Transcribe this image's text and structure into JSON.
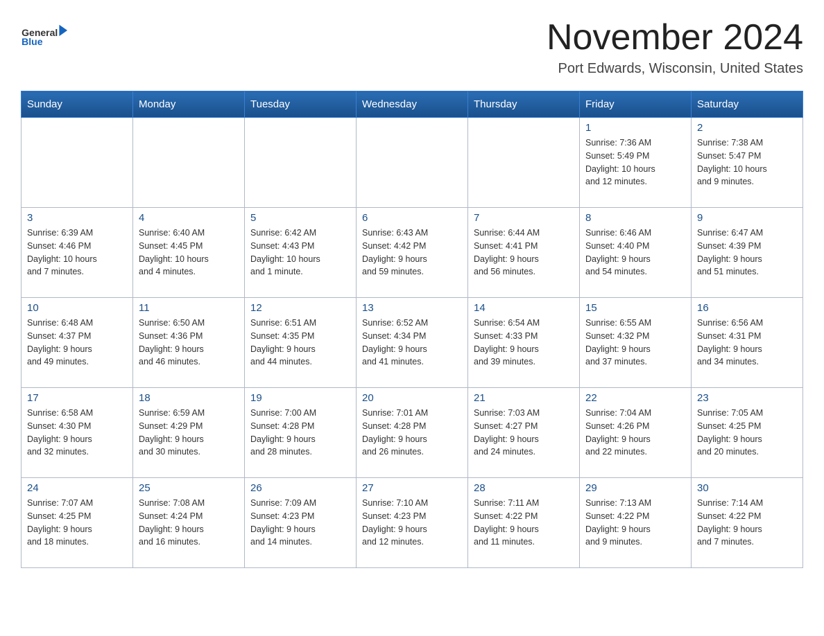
{
  "header": {
    "logo_text_general": "General",
    "logo_text_blue": "Blue",
    "title": "November 2024",
    "subtitle": "Port Edwards, Wisconsin, United States"
  },
  "calendar": {
    "days_of_week": [
      "Sunday",
      "Monday",
      "Tuesday",
      "Wednesday",
      "Thursday",
      "Friday",
      "Saturday"
    ],
    "weeks": [
      [
        {
          "day": "",
          "info": ""
        },
        {
          "day": "",
          "info": ""
        },
        {
          "day": "",
          "info": ""
        },
        {
          "day": "",
          "info": ""
        },
        {
          "day": "",
          "info": ""
        },
        {
          "day": "1",
          "info": "Sunrise: 7:36 AM\nSunset: 5:49 PM\nDaylight: 10 hours\nand 12 minutes."
        },
        {
          "day": "2",
          "info": "Sunrise: 7:38 AM\nSunset: 5:47 PM\nDaylight: 10 hours\nand 9 minutes."
        }
      ],
      [
        {
          "day": "3",
          "info": "Sunrise: 6:39 AM\nSunset: 4:46 PM\nDaylight: 10 hours\nand 7 minutes."
        },
        {
          "day": "4",
          "info": "Sunrise: 6:40 AM\nSunset: 4:45 PM\nDaylight: 10 hours\nand 4 minutes."
        },
        {
          "day": "5",
          "info": "Sunrise: 6:42 AM\nSunset: 4:43 PM\nDaylight: 10 hours\nand 1 minute."
        },
        {
          "day": "6",
          "info": "Sunrise: 6:43 AM\nSunset: 4:42 PM\nDaylight: 9 hours\nand 59 minutes."
        },
        {
          "day": "7",
          "info": "Sunrise: 6:44 AM\nSunset: 4:41 PM\nDaylight: 9 hours\nand 56 minutes."
        },
        {
          "day": "8",
          "info": "Sunrise: 6:46 AM\nSunset: 4:40 PM\nDaylight: 9 hours\nand 54 minutes."
        },
        {
          "day": "9",
          "info": "Sunrise: 6:47 AM\nSunset: 4:39 PM\nDaylight: 9 hours\nand 51 minutes."
        }
      ],
      [
        {
          "day": "10",
          "info": "Sunrise: 6:48 AM\nSunset: 4:37 PM\nDaylight: 9 hours\nand 49 minutes."
        },
        {
          "day": "11",
          "info": "Sunrise: 6:50 AM\nSunset: 4:36 PM\nDaylight: 9 hours\nand 46 minutes."
        },
        {
          "day": "12",
          "info": "Sunrise: 6:51 AM\nSunset: 4:35 PM\nDaylight: 9 hours\nand 44 minutes."
        },
        {
          "day": "13",
          "info": "Sunrise: 6:52 AM\nSunset: 4:34 PM\nDaylight: 9 hours\nand 41 minutes."
        },
        {
          "day": "14",
          "info": "Sunrise: 6:54 AM\nSunset: 4:33 PM\nDaylight: 9 hours\nand 39 minutes."
        },
        {
          "day": "15",
          "info": "Sunrise: 6:55 AM\nSunset: 4:32 PM\nDaylight: 9 hours\nand 37 minutes."
        },
        {
          "day": "16",
          "info": "Sunrise: 6:56 AM\nSunset: 4:31 PM\nDaylight: 9 hours\nand 34 minutes."
        }
      ],
      [
        {
          "day": "17",
          "info": "Sunrise: 6:58 AM\nSunset: 4:30 PM\nDaylight: 9 hours\nand 32 minutes."
        },
        {
          "day": "18",
          "info": "Sunrise: 6:59 AM\nSunset: 4:29 PM\nDaylight: 9 hours\nand 30 minutes."
        },
        {
          "day": "19",
          "info": "Sunrise: 7:00 AM\nSunset: 4:28 PM\nDaylight: 9 hours\nand 28 minutes."
        },
        {
          "day": "20",
          "info": "Sunrise: 7:01 AM\nSunset: 4:28 PM\nDaylight: 9 hours\nand 26 minutes."
        },
        {
          "day": "21",
          "info": "Sunrise: 7:03 AM\nSunset: 4:27 PM\nDaylight: 9 hours\nand 24 minutes."
        },
        {
          "day": "22",
          "info": "Sunrise: 7:04 AM\nSunset: 4:26 PM\nDaylight: 9 hours\nand 22 minutes."
        },
        {
          "day": "23",
          "info": "Sunrise: 7:05 AM\nSunset: 4:25 PM\nDaylight: 9 hours\nand 20 minutes."
        }
      ],
      [
        {
          "day": "24",
          "info": "Sunrise: 7:07 AM\nSunset: 4:25 PM\nDaylight: 9 hours\nand 18 minutes."
        },
        {
          "day": "25",
          "info": "Sunrise: 7:08 AM\nSunset: 4:24 PM\nDaylight: 9 hours\nand 16 minutes."
        },
        {
          "day": "26",
          "info": "Sunrise: 7:09 AM\nSunset: 4:23 PM\nDaylight: 9 hours\nand 14 minutes."
        },
        {
          "day": "27",
          "info": "Sunrise: 7:10 AM\nSunset: 4:23 PM\nDaylight: 9 hours\nand 12 minutes."
        },
        {
          "day": "28",
          "info": "Sunrise: 7:11 AM\nSunset: 4:22 PM\nDaylight: 9 hours\nand 11 minutes."
        },
        {
          "day": "29",
          "info": "Sunrise: 7:13 AM\nSunset: 4:22 PM\nDaylight: 9 hours\nand 9 minutes."
        },
        {
          "day": "30",
          "info": "Sunrise: 7:14 AM\nSunset: 4:22 PM\nDaylight: 9 hours\nand 7 minutes."
        }
      ]
    ]
  }
}
